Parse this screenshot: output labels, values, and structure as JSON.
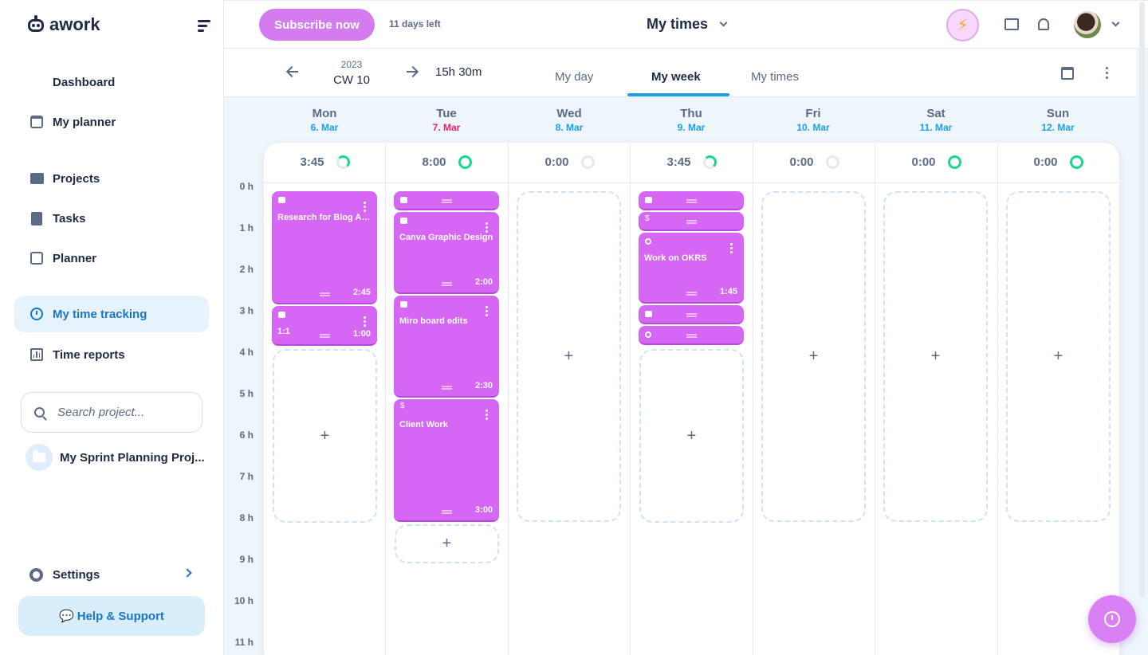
{
  "app": {
    "logo_text": "awork"
  },
  "sidebar": {
    "nav": [
      {
        "label": "Dashboard"
      },
      {
        "label": "My planner"
      },
      {
        "label": "Projects"
      },
      {
        "label": "Tasks"
      },
      {
        "label": "Planner"
      },
      {
        "label": "My time tracking"
      },
      {
        "label": "Time reports"
      }
    ],
    "search_placeholder": "Search project...",
    "project_name": "My Sprint Planning Proj...",
    "settings_label": "Settings",
    "help_label": "Help & Support",
    "help_emoji": "💬"
  },
  "topbar": {
    "subscribe_label": "Subscribe now",
    "trial_text": "11 days left",
    "title": "My times",
    "bolt": "⚡"
  },
  "subbar": {
    "year": "2023",
    "week": "CW 10",
    "total": "15h 30m",
    "tabs": [
      {
        "label": "My day"
      },
      {
        "label": "My week"
      },
      {
        "label": "My times"
      }
    ]
  },
  "days": [
    {
      "name": "Mon",
      "date": "6. Mar",
      "total": "3:45"
    },
    {
      "name": "Tue",
      "date": "7. Mar",
      "total": "8:00"
    },
    {
      "name": "Wed",
      "date": "8. Mar",
      "total": "0:00"
    },
    {
      "name": "Thu",
      "date": "9. Mar",
      "total": "3:45"
    },
    {
      "name": "Fri",
      "date": "10. Mar",
      "total": "0:00"
    },
    {
      "name": "Sat",
      "date": "11. Mar",
      "total": "0:00"
    },
    {
      "name": "Sun",
      "date": "12. Mar",
      "total": "0:00"
    }
  ],
  "hours": [
    "0 h",
    "1 h",
    "2 h",
    "3 h",
    "4 h",
    "5 h",
    "6 h",
    "7 h",
    "8 h",
    "9 h",
    "10 h",
    "11 h"
  ],
  "entries": {
    "mon": [
      {
        "title": "Research for Blog Ar...",
        "duration": "2:45"
      },
      {
        "title": "1:1",
        "duration": "1:00"
      }
    ],
    "tue": [
      {
        "title": "Canva Graphic Design",
        "duration": "2:00"
      },
      {
        "title": "Miro board edits",
        "duration": "2:30"
      },
      {
        "title": "Client Work",
        "duration": "3:00",
        "icon": "$"
      }
    ],
    "thu": [
      {
        "icon": "$"
      },
      {
        "title": "Work on OKRS",
        "duration": "1:45"
      }
    ]
  },
  "add_symbol": "+"
}
